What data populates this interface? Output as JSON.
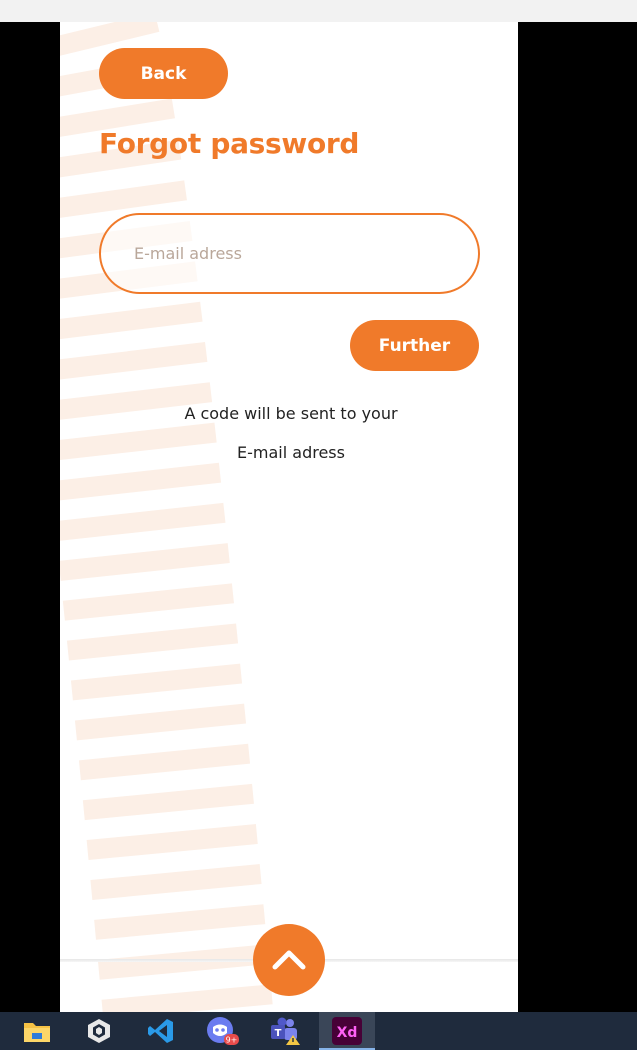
{
  "colors": {
    "accent": "#f07a2a",
    "track": "#fcefe6"
  },
  "back_label": "Back",
  "title": "Forgot password",
  "email": {
    "placeholder": "E-mail adress",
    "value": ""
  },
  "further_label": "Further",
  "hint": {
    "line1": "A code will be sent to your",
    "line2": "E-mail adress"
  },
  "scroll_top_icon": "chevron-up-icon",
  "taskbar": {
    "items": [
      {
        "name": "file-explorer-icon"
      },
      {
        "name": "unity-icon"
      },
      {
        "name": "vscode-icon"
      },
      {
        "name": "discord-icon",
        "badge": "9+"
      },
      {
        "name": "teams-icon"
      },
      {
        "name": "adobe-xd-icon",
        "label": "Xd",
        "active": true
      }
    ]
  }
}
